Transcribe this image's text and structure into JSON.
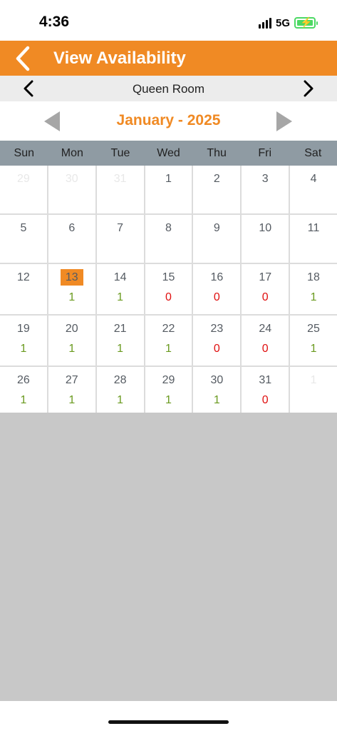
{
  "status": {
    "time": "4:36",
    "network": "5G"
  },
  "nav": {
    "title": "View Availability",
    "back_icon": "chevron-left-icon",
    "color": "#f08a24"
  },
  "room": {
    "name": "Queen Room"
  },
  "month": {
    "title": "January - 2025"
  },
  "weekdays": [
    "Sun",
    "Mon",
    "Tue",
    "Wed",
    "Thu",
    "Fri",
    "Sat"
  ],
  "colors": {
    "available": "#6a9a1f",
    "unavailable": "#e01010",
    "today_highlight": "#f08a24",
    "header_bg": "#8f9ba3"
  },
  "weeks": [
    [
      {
        "day": "29",
        "count": "",
        "muted": true
      },
      {
        "day": "30",
        "count": "",
        "muted": true
      },
      {
        "day": "31",
        "count": "",
        "muted": true
      },
      {
        "day": "1",
        "count": ""
      },
      {
        "day": "2",
        "count": ""
      },
      {
        "day": "3",
        "count": ""
      },
      {
        "day": "4",
        "count": ""
      }
    ],
    [
      {
        "day": "5",
        "count": ""
      },
      {
        "day": "6",
        "count": ""
      },
      {
        "day": "7",
        "count": ""
      },
      {
        "day": "8",
        "count": ""
      },
      {
        "day": "9",
        "count": ""
      },
      {
        "day": "10",
        "count": ""
      },
      {
        "day": "11",
        "count": ""
      }
    ],
    [
      {
        "day": "12",
        "count": ""
      },
      {
        "day": "13",
        "count": "1",
        "today": true
      },
      {
        "day": "14",
        "count": "1"
      },
      {
        "day": "15",
        "count": "0"
      },
      {
        "day": "16",
        "count": "0"
      },
      {
        "day": "17",
        "count": "0"
      },
      {
        "day": "18",
        "count": "1"
      }
    ],
    [
      {
        "day": "19",
        "count": "1"
      },
      {
        "day": "20",
        "count": "1"
      },
      {
        "day": "21",
        "count": "1"
      },
      {
        "day": "22",
        "count": "1"
      },
      {
        "day": "23",
        "count": "0"
      },
      {
        "day": "24",
        "count": "0"
      },
      {
        "day": "25",
        "count": "1"
      }
    ],
    [
      {
        "day": "26",
        "count": "1"
      },
      {
        "day": "27",
        "count": "1"
      },
      {
        "day": "28",
        "count": "1"
      },
      {
        "day": "29",
        "count": "1"
      },
      {
        "day": "30",
        "count": "1"
      },
      {
        "day": "31",
        "count": "0"
      },
      {
        "day": "1",
        "count": "",
        "muted": true
      }
    ]
  ]
}
